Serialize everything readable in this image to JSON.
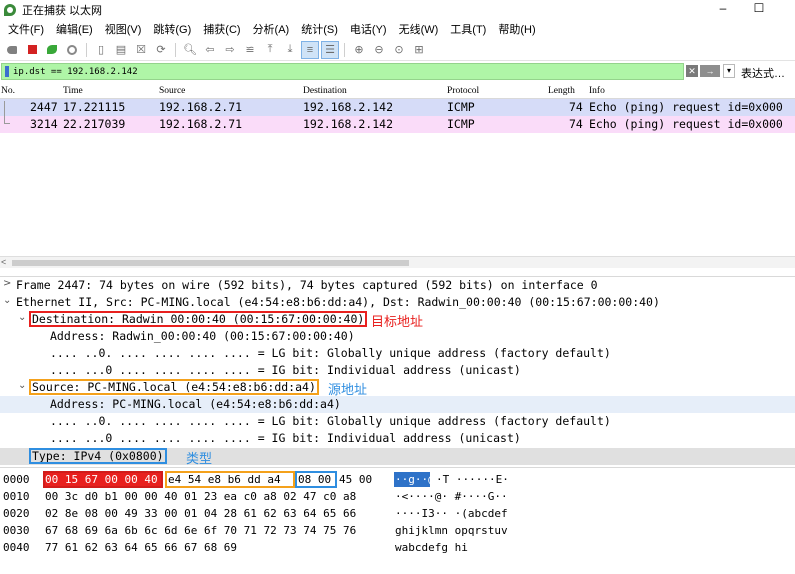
{
  "window": {
    "title": "正在捕获 以太网",
    "minimize": "–",
    "maximize": "☐"
  },
  "menu": [
    "文件(F)",
    "编辑(E)",
    "视图(V)",
    "跳转(G)",
    "捕获(C)",
    "分析(A)",
    "统计(S)",
    "电话(Y)",
    "无线(W)",
    "工具(T)",
    "帮助(H)"
  ],
  "toolbar_icons": [
    "shark-fin-icon",
    "stop-icon",
    "restart-icon",
    "options-icon",
    "open-icon",
    "save-icon",
    "close-icon",
    "reload-icon",
    "find-icon",
    "back-icon",
    "forward-icon",
    "goto-icon",
    "first-icon",
    "last-icon",
    "autoscroll-icon",
    "colorize-icon",
    "zoom-in-icon",
    "zoom-out-icon",
    "zoom-normal-icon",
    "resize-columns-icon"
  ],
  "filter": {
    "value": "ip.dst == 192.168.2.142",
    "expression_label": "表达式…",
    "clear_glyph": "✕",
    "apply_glyph": "→",
    "dropdown_glyph": "▾"
  },
  "packet_list": {
    "columns": [
      "No.",
      "Time",
      "Source",
      "Destination",
      "Protocol",
      "Length",
      "Info"
    ],
    "rows": [
      {
        "no": "2447",
        "time": "17.221115",
        "source": "192.168.2.71",
        "destination": "192.168.2.142",
        "protocol": "ICMP",
        "length": "74",
        "info": "Echo (ping) request  id=0x000"
      },
      {
        "no": "3214",
        "time": "22.217039",
        "source": "192.168.2.71",
        "destination": "192.168.2.142",
        "protocol": "ICMP",
        "length": "74",
        "info": "Echo (ping) request  id=0x000"
      }
    ],
    "scroll_left": "<"
  },
  "details": {
    "frame": "Frame 2447: 74 bytes on wire (592 bits), 74 bytes captured (592 bits) on interface 0",
    "ethernet": "Ethernet II, Src: PC-MING.local (e4:54:e8:b6:dd:a4), Dst: Radwin_00:00:40 (00:15:67:00:00:40)",
    "destination": "Destination: Radwin_00:00:40 (00:15:67:00:00:40)",
    "dst_address": "Address: Radwin_00:00:40 (00:15:67:00:00:40)",
    "dst_lg": ".... ..0. .... .... .... .... = LG bit: Globally unique address (factory default)",
    "dst_ig": ".... ...0 .... .... .... .... = IG bit: Individual address (unicast)",
    "source": "Source: PC-MING.local (e4:54:e8:b6:dd:a4)",
    "src_address": "Address: PC-MING.local (e4:54:e8:b6:dd:a4)",
    "src_lg": ".... ..0. .... .... .... .... = LG bit: Globally unique address (factory default)",
    "src_ig": ".... ...0 .... .... .... .... = IG bit: Individual address (unicast)",
    "type": "Type: IPv4 (0x0800)",
    "ann_destination": "目标地址",
    "ann_source": "源地址",
    "ann_type": "类型",
    "collapsed_glyph": ">",
    "expanded_glyph": "⌄"
  },
  "bytes": {
    "offsets": [
      "0000",
      "0010",
      "0020",
      "0030",
      "0040"
    ],
    "row0": {
      "red": "00 15 67 00 00 40",
      "orange": "e4 54  e8 b6 dd a4",
      "blue": "08 00",
      "rest": "45 00",
      "ascii_hl": "··g··@",
      "ascii_rest": "·T  ······E·"
    },
    "hex": [
      "00 3c d0 b1 00 00 40 01  23 ea c0 a8 02 47 c0 a8",
      "02 8e 08 00 49 33 00 01  04 28 61 62 63 64 65 66",
      "67 68 69 6a 6b 6c 6d 6e  6f 70 71 72 73 74 75 76",
      "77 61 62 63 64 65 66 67  68 69"
    ],
    "ascii": [
      "·<····@· #····G··",
      "····I3·· ·(abcdef",
      "ghijklmn opqrstuv",
      "wabcdefg hi"
    ]
  },
  "colors": {
    "filter_bg": "#aff5a7",
    "row1_bg": "#d6dcf8",
    "row2_bg": "#fadcf9",
    "annotation_red": "#e8201e",
    "annotation_orange": "#f4a11b",
    "annotation_blue": "#2f8ee0"
  }
}
